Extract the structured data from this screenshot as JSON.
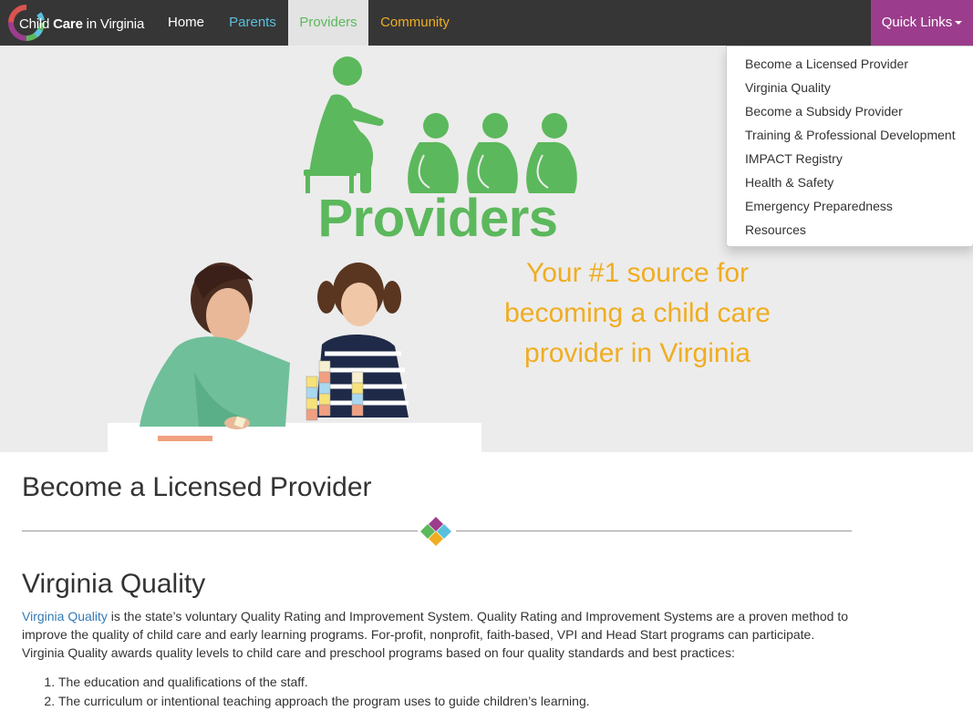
{
  "brand": {
    "logo_part1": "Child",
    "logo_part2": "Care",
    "logo_part3": " in Virginia"
  },
  "nav": {
    "home": "Home",
    "parents": "Parents",
    "providers": "Providers",
    "community": "Community",
    "quick_links": "Quick Links"
  },
  "colors": {
    "navbar": "#363636",
    "parents": "#5bc0de",
    "providers": "#5cb85c",
    "community": "#f0ad22",
    "quick_links": "#9b3d8c",
    "link": "#337ab7"
  },
  "dropdown": {
    "items": [
      "Become a Licensed Provider",
      "Virginia Quality",
      "Become a Subsidy Provider",
      "Training & Professional Development",
      "IMPACT Registry",
      "Health & Safety",
      "Emergency Preparedness",
      "Resources"
    ]
  },
  "hero": {
    "title": "Providers",
    "tagline": "Your #1 source for becoming a child care provider in Virginia",
    "icon": "teacher-and-children-icon",
    "photo": "woman-and-girl-with-blocks-photo"
  },
  "main": {
    "section_title": "Become a Licensed Provider",
    "divider_icon": "four-diamond-icon",
    "subsection_title": "Virginia Quality",
    "paragraph_link": "Virginia Quality",
    "paragraph_text": " is the state’s voluntary Quality Rating and Improvement System. Quality Rating and Improvement Systems are a proven method to improve the quality of child care and early learning programs. For-profit, nonprofit, faith-based, VPI and Head Start programs can participate. Virginia Quality awards quality levels to child care and preschool programs based on four quality standards and best practices:",
    "list": [
      "The education and qualifications of the staff.",
      "The curriculum or intentional teaching approach the program uses to guide children’s learning."
    ]
  }
}
